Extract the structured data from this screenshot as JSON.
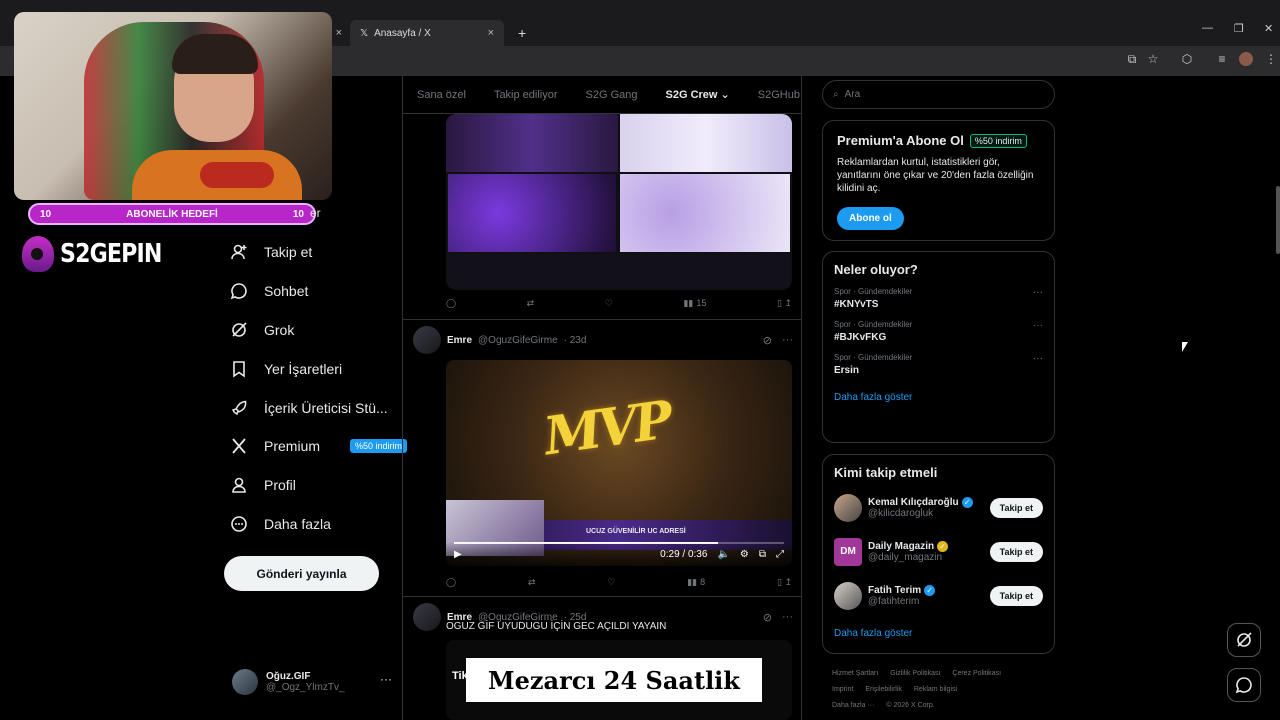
{
  "browser": {
    "tab_title": "Anasayfa / X",
    "new_tab": "+",
    "tab_close": "×",
    "minimize": "—",
    "restore": "❐",
    "close": "✕"
  },
  "overlay": {
    "goal_left": "10",
    "goal_label": "ABONELİK HEDEFİ",
    "goal_right": "10",
    "goal_tail": "er",
    "logo_text": "S2GEPIN"
  },
  "nav": {
    "items": [
      {
        "label": "Takip et",
        "icon": "add-user-icon"
      },
      {
        "label": "Sohbet",
        "icon": "chat-icon"
      },
      {
        "label": "Grok",
        "icon": "grok-icon"
      },
      {
        "label": "Yer İşaretleri",
        "icon": "bookmark-icon"
      },
      {
        "label": "İçerik Üreticisi Stü...",
        "icon": "rocket-icon"
      },
      {
        "label": "Premium",
        "icon": "x-logo-icon"
      },
      {
        "label": "Profil",
        "icon": "person-icon"
      },
      {
        "label": "Daha fazla",
        "icon": "more-circle-icon"
      }
    ],
    "premium_badge": "%50 indirim",
    "post_button": "Gönderi yayınla",
    "account_name": "Oğuz.GIF",
    "account_handle": "@_Ogz_YlmzTv_",
    "account_more": "···"
  },
  "timeline": {
    "tabs": [
      "Sana özel",
      "Takip ediliyor",
      "S2G Gang",
      "S2G Crew",
      "S2GHub"
    ],
    "active_tab": "S2G Crew",
    "post1": {
      "views": "15"
    },
    "post2": {
      "name": "Emre",
      "handle": "@OguzGifeGirme",
      "time": "· 23d",
      "video_time": "0:29 / 0:36",
      "video_progress": 0.8,
      "banner_text": "UCUZ GÜVENİLİR UC ADRESİ",
      "mvp_text": "MVP",
      "views": "8"
    },
    "post3": {
      "name": "Emre",
      "handle": "@OguzGifeGirme",
      "time": "· 25d",
      "text": "OGUZ GİF UYUDUGU İÇİN GEC AÇILDI YAYAIN",
      "tiktok_label": "TikTok",
      "banner": "Mezarcı 24 Saatlik"
    }
  },
  "sidebar": {
    "search_placeholder": "Ara",
    "premium": {
      "title": "Premium'a Abone Ol",
      "badge": "%50 indirim",
      "desc": "Reklamlardan kurtul, istatistikleri gör, yanıtlarını öne çıkar ve 20'den fazla özelliğin kilidini aç.",
      "button": "Abone ol"
    },
    "trends": {
      "title": "Neler oluyor?",
      "items": [
        {
          "meta": "Spor · Gündemdekiler",
          "tag": "#KNYvTS"
        },
        {
          "meta": "Spor · Gündemdekiler",
          "tag": "#BJKvFKG"
        },
        {
          "meta": "Spor · Gündemdekiler",
          "tag": "Ersin"
        }
      ],
      "show_more": "Daha fazla göster"
    },
    "who_to_follow": {
      "title": "Kimi takip etmeli",
      "items": [
        {
          "name": "Kemal Kılıçdaroğlu",
          "handle": "@kilicdarogluk",
          "verify_color": "#1d9bf0",
          "button": "Takip et"
        },
        {
          "name": "Daily Magazin",
          "handle": "@daily_magazin",
          "verify_color": "#e2b719",
          "button": "Takip et"
        },
        {
          "name": "Fatih Terim",
          "handle": "@fatihterim",
          "verify_color": "#1d9bf0",
          "button": "Takip et"
        }
      ],
      "show_more": "Daha fazla göster"
    },
    "footer": {
      "links": [
        "Hizmet Şartları",
        "Gizlilik Politikası",
        "Çerez Politikası",
        "Imprint",
        "Erişilebilirlik",
        "Reklam bilgisi",
        "Daha fazla ···"
      ],
      "copyright": "© 2026 X Corp."
    }
  }
}
